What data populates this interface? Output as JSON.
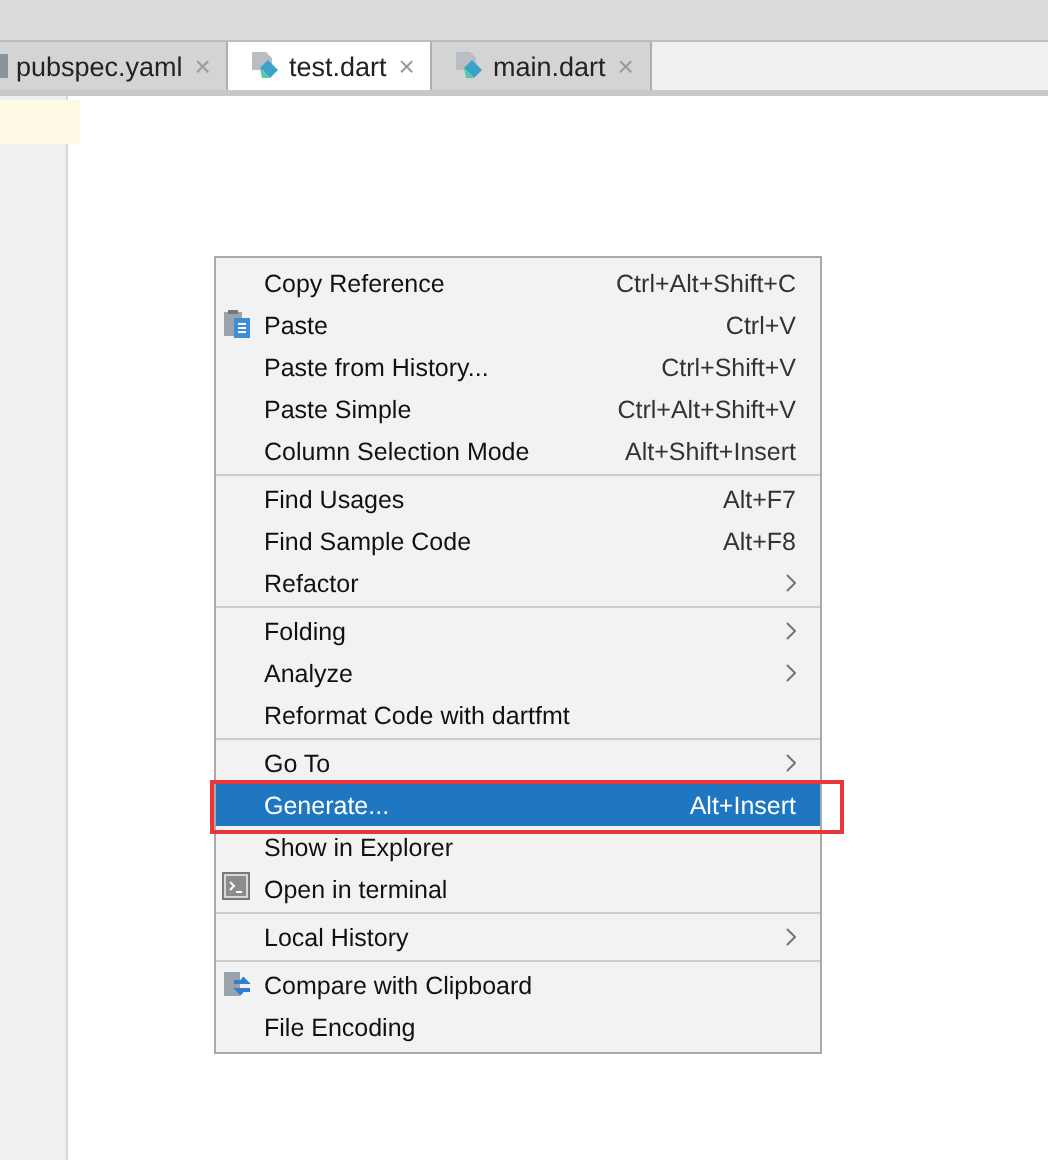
{
  "tabs": [
    {
      "label": "pubspec.yaml",
      "selected": false,
      "kind": "yaml",
      "close": "×"
    },
    {
      "label": "test.dart",
      "selected": true,
      "kind": "dart",
      "close": "×"
    },
    {
      "label": "main.dart",
      "selected": false,
      "kind": "dart",
      "close": "×"
    }
  ],
  "context_menu": {
    "groups": [
      [
        {
          "label": "Copy Reference",
          "shortcut": "Ctrl+Alt+Shift+C",
          "submenu": false,
          "selected": false,
          "callout": false
        },
        {
          "label": "Paste",
          "shortcut": "Ctrl+V",
          "submenu": false,
          "selected": false,
          "callout": false,
          "kind": "paste"
        },
        {
          "label": "Paste from History...",
          "shortcut": "Ctrl+Shift+V",
          "submenu": false,
          "selected": false,
          "callout": false
        },
        {
          "label": "Paste Simple",
          "shortcut": "Ctrl+Alt+Shift+V",
          "submenu": false,
          "selected": false,
          "callout": false
        },
        {
          "label": "Column Selection Mode",
          "shortcut": "Alt+Shift+Insert",
          "submenu": false,
          "selected": false,
          "callout": false
        }
      ],
      [
        {
          "label": "Find Usages",
          "shortcut": "Alt+F7",
          "submenu": false,
          "selected": false,
          "callout": false
        },
        {
          "label": "Find Sample Code",
          "shortcut": "Alt+F8",
          "submenu": false,
          "selected": false,
          "callout": false
        },
        {
          "label": "Refactor",
          "submenu": true,
          "selected": false,
          "callout": false
        }
      ],
      [
        {
          "label": "Folding",
          "submenu": true,
          "selected": false,
          "callout": false
        },
        {
          "label": "Analyze",
          "submenu": true,
          "selected": false,
          "callout": false
        },
        {
          "label": "Reformat Code with dartfmt",
          "submenu": false,
          "selected": false,
          "callout": false
        }
      ],
      [
        {
          "label": "Go To",
          "submenu": true,
          "selected": false,
          "callout": false
        },
        {
          "label": "Generate...",
          "shortcut": "Alt+Insert",
          "submenu": false,
          "selected": true,
          "callout": true
        },
        {
          "label": "Show in Explorer",
          "submenu": false,
          "selected": false,
          "callout": false
        },
        {
          "label": "Open in terminal",
          "submenu": false,
          "selected": false,
          "callout": false,
          "kind": "terminal"
        }
      ],
      [
        {
          "label": "Local History",
          "submenu": true,
          "selected": false,
          "callout": false
        }
      ],
      [
        {
          "label": "Compare with Clipboard",
          "submenu": false,
          "selected": false,
          "callout": false,
          "kind": "compare"
        },
        {
          "label": "File Encoding",
          "submenu": false,
          "selected": false,
          "callout": false
        }
      ]
    ]
  }
}
